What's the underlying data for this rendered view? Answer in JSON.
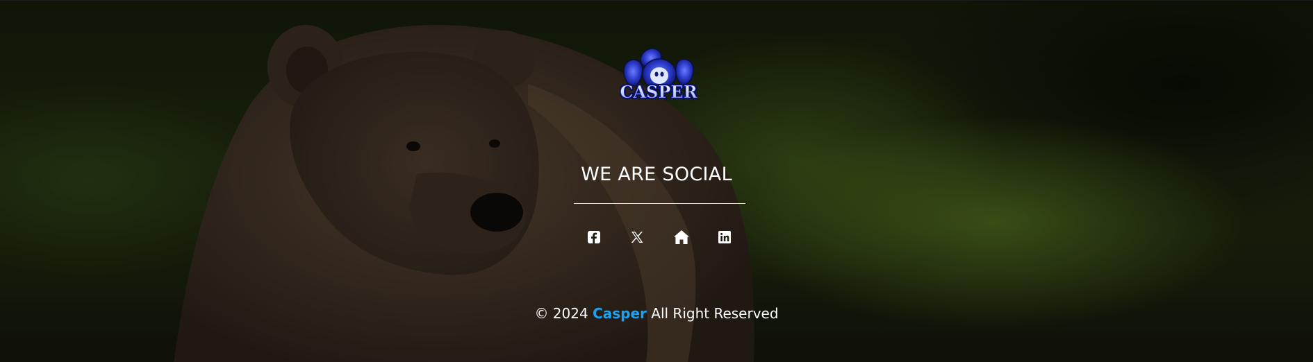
{
  "logo": {
    "text": "CASPER",
    "icon": "casper-ghost-logo"
  },
  "social": {
    "title": "WE ARE SOCIAL",
    "links": [
      {
        "name": "facebook",
        "icon": "facebook-icon"
      },
      {
        "name": "x-twitter",
        "icon": "x-twitter-icon"
      },
      {
        "name": "home",
        "icon": "home-icon"
      },
      {
        "name": "linkedin",
        "icon": "linkedin-icon"
      }
    ]
  },
  "footer": {
    "copyright_prefix": "© 2024",
    "brand": "Casper",
    "copyright_suffix": "All Right Reserved"
  },
  "colors": {
    "brand_link": "#1aa3f2",
    "text": "#ffffff"
  }
}
